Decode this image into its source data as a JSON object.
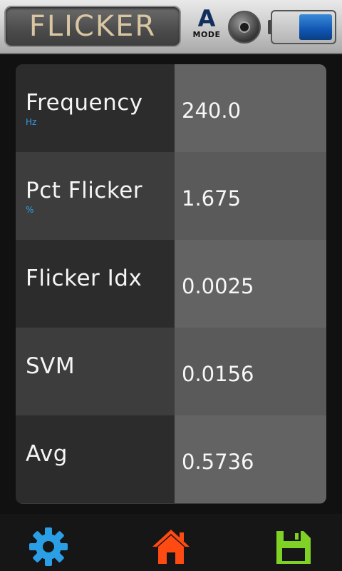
{
  "header": {
    "title": "FLICKER",
    "mode_letter": "A",
    "mode_label": "MODE",
    "battery_level": 0.55
  },
  "rows": [
    {
      "label": "Frequency",
      "unit": "Hz",
      "value": "240.0"
    },
    {
      "label": "Pct Flicker",
      "unit": "%",
      "value": "1.675"
    },
    {
      "label": "Flicker Idx",
      "unit": "",
      "value": "0.0025"
    },
    {
      "label": "SVM",
      "unit": "",
      "value": "0.0156"
    },
    {
      "label": "Avg",
      "unit": "",
      "value": "0.5736"
    }
  ],
  "nav": {
    "settings_icon": "gear-icon",
    "home_icon": "home-icon",
    "save_icon": "floppy-disk-icon"
  },
  "colors": {
    "settings": "#2a9fe6",
    "home": "#ff4a12",
    "save": "#7fd126",
    "unit_text": "#2ea0e6",
    "title_text": "#d9c6a2"
  }
}
